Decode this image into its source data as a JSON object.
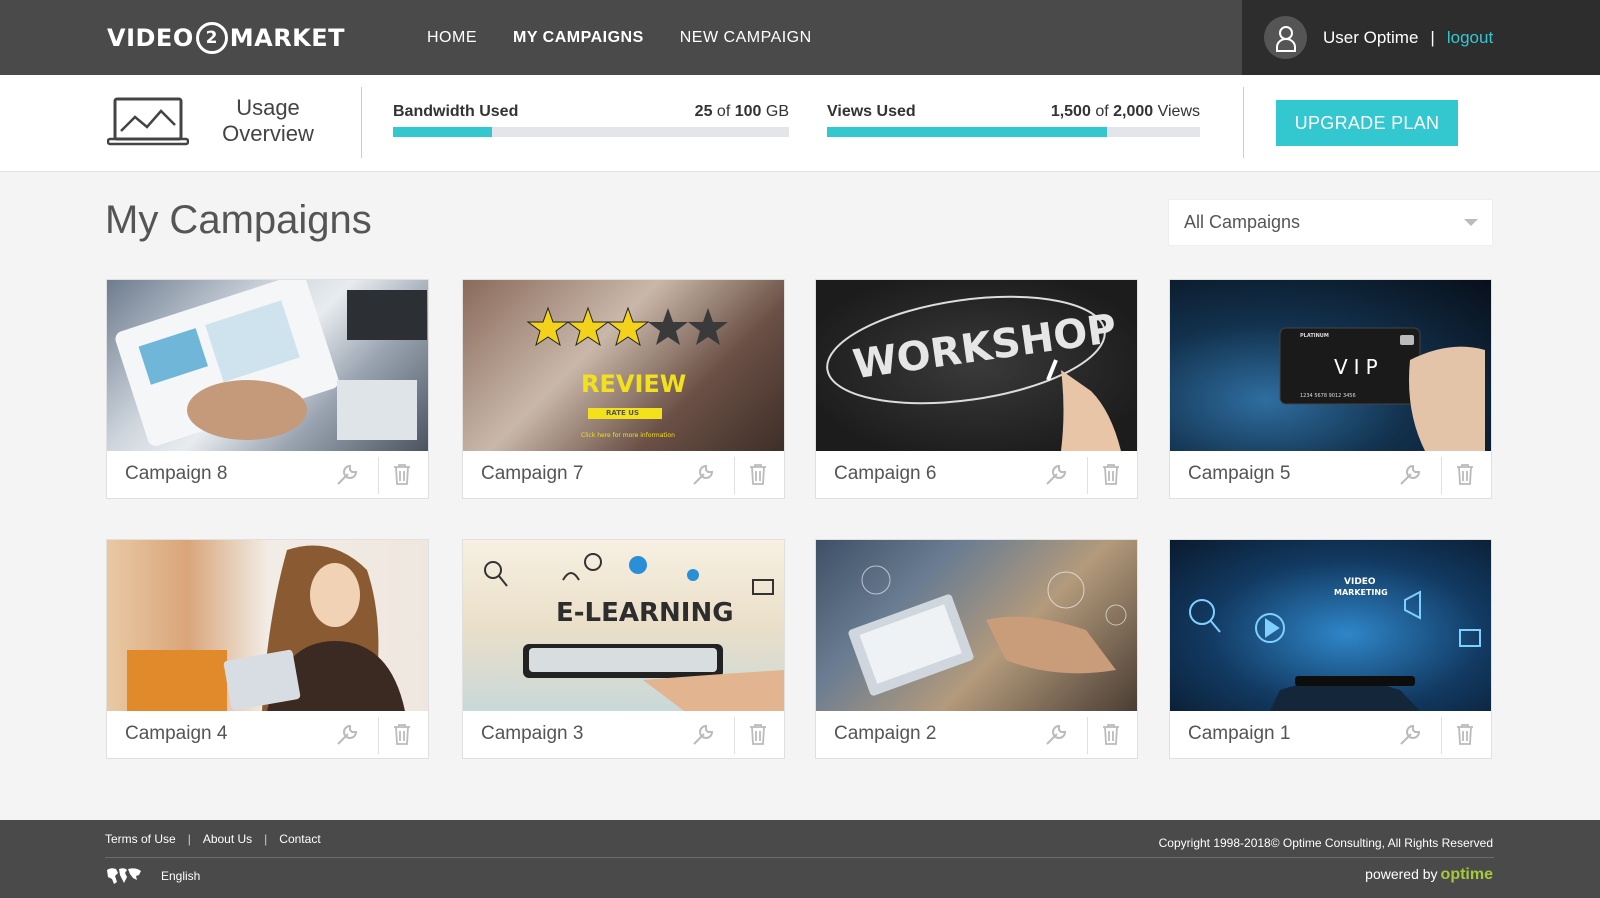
{
  "brand": {
    "left": "VIDEO",
    "mid": "2",
    "right": "MARKET"
  },
  "nav": [
    {
      "label": "HOME"
    },
    {
      "label": "MY CAMPAIGNS",
      "active": true
    },
    {
      "label": "NEW CAMPAIGN"
    }
  ],
  "user": {
    "name": "User Optime",
    "separator": "|",
    "logout": "logout"
  },
  "usage": {
    "title_line1": "Usage",
    "title_line2": "Overview",
    "bandwidth": {
      "label": "Bandwidth Used",
      "used": "25",
      "of": "of",
      "total": "100",
      "unit": "GB",
      "fraction": 0.25
    },
    "views": {
      "label": "Views Used",
      "used": "1,500",
      "of": "of",
      "total": "2,000",
      "unit": "Views",
      "fraction": 0.75
    },
    "upgrade": "UPGRADE PLAN"
  },
  "main": {
    "title": "My Campaigns",
    "filter": "All Campaigns"
  },
  "campaigns": [
    {
      "name": "Campaign 8"
    },
    {
      "name": "Campaign 7",
      "thumb_text": "REVIEW",
      "thumb_sub": "RATE US",
      "thumb_note": "Click here for more information"
    },
    {
      "name": "Campaign 6",
      "thumb_text": "WORKSHOP"
    },
    {
      "name": "Campaign 5",
      "thumb_text": "VIP",
      "thumb_sub": "PLATINUM",
      "thumb_note": "1234 5678 9012 3456"
    },
    {
      "name": "Campaign 4"
    },
    {
      "name": "Campaign 3",
      "thumb_text": "E-LEARNING"
    },
    {
      "name": "Campaign 2"
    },
    {
      "name": "Campaign 1",
      "thumb_text": "VIDEO",
      "thumb_sub": "MARKETING"
    }
  ],
  "footer": {
    "links": [
      "Terms of Use",
      "About Us",
      "Contact"
    ],
    "copyright": "Copyright 1998-2018© Optime Consulting, All Rights Reserved",
    "language": "English",
    "powered_by": "powered by",
    "powered_brand": "optime"
  },
  "colors": {
    "accent": "#33c7d0",
    "header": "#4a4a4a",
    "header_dark": "#2d2d2d",
    "brand_green": "#a7c93a"
  }
}
